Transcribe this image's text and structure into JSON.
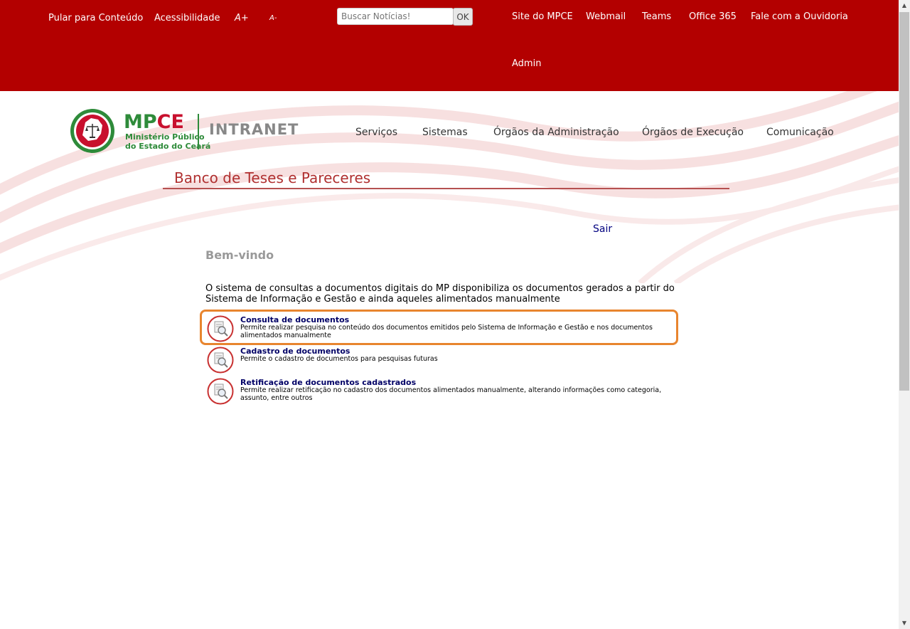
{
  "topbar": {
    "skip_link": "Pular para Conteúdo",
    "accessibility": "Acessibilidade",
    "font_increase": "A+",
    "font_decrease": "A-",
    "search_placeholder": "Buscar Notícias!",
    "search_button": "OK",
    "links": [
      "Site do MPCE",
      "Webmail",
      "Teams",
      "Office 365",
      "Fale com a Ouvidoria",
      "Admin"
    ],
    "bg_color": "#b30000"
  },
  "logo": {
    "brand_mp": "MP",
    "brand_ce": "CE",
    "subtitle_line1": "Ministério Público",
    "subtitle_line2": "do Estado do Ceará",
    "intranet": "INTRANET"
  },
  "nav": [
    "Serviços",
    "Sistemas",
    "Órgãos da Administração",
    "Órgãos de Execução",
    "Comunicação"
  ],
  "page": {
    "heading": "Banco de Teses e Pareceres",
    "logout": "Sair",
    "welcome": "Bem-vindo",
    "description": "O sistema de consultas a documentos digitais do MP disponibiliza os documentos gerados a partir do Sistema de Informação e Gestão e ainda aqueles alimentados manualmente"
  },
  "items": [
    {
      "title": "Consulta de documentos",
      "text": "Permite realizar pesquisa no conteúdo dos documentos emitidos pelo Sistema de Informação e Gestão e nos documentos alimentados manualmente",
      "icon": "document-search-icon"
    },
    {
      "title": "Cadastro de documentos",
      "text": "Permite o cadastro de documentos para pesquisas futuras",
      "icon": "document-search-icon"
    },
    {
      "title": "Retificação de documentos cadastrados",
      "text": "Permite realizar retificação no cadastro dos documentos alimentados manualmente, alterando informações como categoria, assunto, entre outros",
      "icon": "document-search-icon"
    }
  ],
  "colors": {
    "accent_red": "#b30000",
    "heading_red": "#b03030",
    "logo_green": "#2e8b3a",
    "highlight_orange": "#e8852e",
    "link_navy": "#000066"
  }
}
